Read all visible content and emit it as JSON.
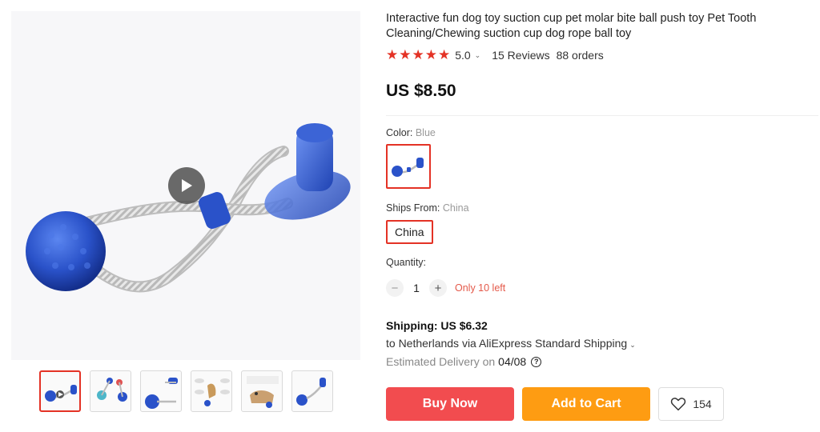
{
  "product": {
    "title": "Interactive fun dog toy suction cup pet molar bite ball push toy Pet Tooth Cleaning/Chewing suction cup dog rope ball toy",
    "stars": "★★★★★",
    "rating": "5.0",
    "reviews": "15 Reviews",
    "orders": "88 orders",
    "price": "US $8.50"
  },
  "options": {
    "color_label": "Color:",
    "color_value": "Blue",
    "ships_from_label": "Ships From:",
    "ships_from_value": "China",
    "ships_chip": "China",
    "quantity_label": "Quantity:",
    "quantity_minus": "−",
    "quantity_value": "1",
    "quantity_plus": "+",
    "stock_note": "Only 10 left"
  },
  "shipping": {
    "cost": "Shipping: US $6.32",
    "route": "to Netherlands via AliExpress Standard Shipping",
    "delivery_label": "Estimated Delivery on",
    "delivery_date": "04/08",
    "help": "?"
  },
  "actions": {
    "buy_now": "Buy Now",
    "add_to_cart": "Add to Cart",
    "wishlist_count": "154"
  },
  "gallery": {
    "thumbnail_count": 6,
    "active_index": 0
  },
  "colors": {
    "accent_red": "#e43225",
    "buy_button": "#f24c4f",
    "cart_button": "#fe9c12",
    "toy_blue": "#2a52c9"
  }
}
